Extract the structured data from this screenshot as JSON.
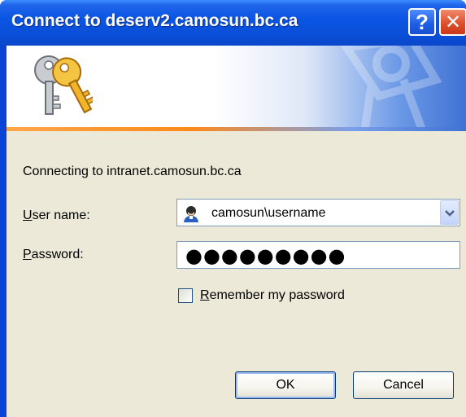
{
  "window": {
    "title": "Connect to deserv2.camosun.bc.ca",
    "help_label": "?",
    "close_label": "✕"
  },
  "dialog": {
    "connecting_text": "Connecting to intranet.camosun.bc.ca",
    "username_label_accel": "U",
    "username_label_rest": "ser name:",
    "username_value": "camosun\\username",
    "password_label_accel": "P",
    "password_label_rest": "assword:",
    "password_masked": "●●●●●●●●●",
    "remember_accel": "R",
    "remember_rest": "emember my password",
    "remember_checked": false,
    "ok_label": "OK",
    "cancel_label": "Cancel"
  },
  "icons": {
    "banner": "keys-icon",
    "user": "user-icon",
    "dropdown": "chevron-down-icon"
  },
  "colors": {
    "titlebar": "#0a4fd8",
    "dialog_bg": "#ece9d8",
    "accent_line": "#ff8a1a"
  }
}
